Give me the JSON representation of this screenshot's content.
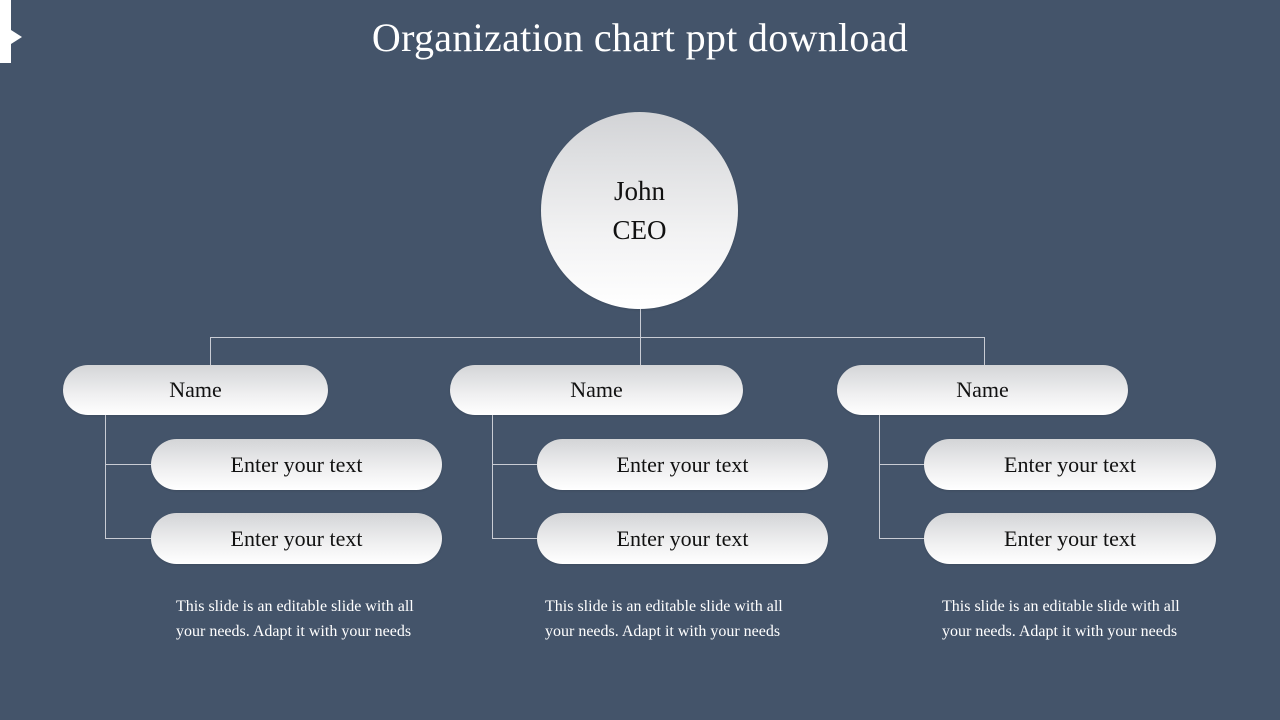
{
  "slide": {
    "title": "Organization chart ppt download",
    "background_color": "#44546A",
    "accent_color": "#FFFFFF",
    "connector_color": "#C9CCD4",
    "node_gradient_top": "#D3D4D6",
    "node_gradient_bottom": "#FFFFFF"
  },
  "decor": {
    "left_tab_name": "left-accent-tab"
  },
  "org_chart": {
    "root": {
      "name": "John",
      "title": "CEO"
    },
    "branches": [
      {
        "label": "Name",
        "children": [
          {
            "label": "Enter your text"
          },
          {
            "label": "Enter your text"
          }
        ],
        "note": "This slide is an editable slide with all your needs. Adapt it with your needs"
      },
      {
        "label": "Name",
        "children": [
          {
            "label": "Enter your text"
          },
          {
            "label": "Enter your text"
          }
        ],
        "note": "This slide is an editable slide with all your needs. Adapt it with your needs"
      },
      {
        "label": "Name",
        "children": [
          {
            "label": "Enter your text"
          },
          {
            "label": "Enter your text"
          }
        ],
        "note": "This slide is an editable slide with all your needs. Adapt it with your needs"
      }
    ]
  }
}
